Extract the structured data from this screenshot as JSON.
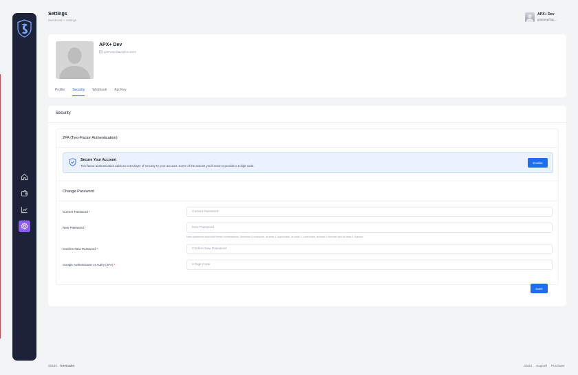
{
  "header": {
    "title": "Settings",
    "breadcrumb": [
      "Dashboard",
      "Settings"
    ],
    "breadcrumb_separator": "•",
    "user": {
      "name": "APX+ Dev",
      "email": "gateway@ap..."
    }
  },
  "sidebar": {
    "items": [
      {
        "name": "home",
        "icon": "home-icon",
        "active": false
      },
      {
        "name": "wallet",
        "icon": "wallet-icon",
        "active": false
      },
      {
        "name": "chart",
        "icon": "chart-line-icon",
        "active": false
      },
      {
        "name": "settings",
        "icon": "gear-icon",
        "active": true
      }
    ],
    "accent": "#8b5cf6"
  },
  "profile": {
    "name": "APX+ Dev",
    "email": "gateway@apxplus.store",
    "tabs": [
      {
        "label": "Profile",
        "active": false
      },
      {
        "label": "Security",
        "active": true
      },
      {
        "label": "Webhook",
        "active": false
      },
      {
        "label": "Api Key",
        "active": false
      }
    ]
  },
  "security": {
    "title": "Security",
    "twofa": {
      "title": "2FA (Two-Factor Authentication)",
      "alert_title": "Secure Your Account",
      "alert_text": "Two-factor authentication adds an extra layer of security to your account. Some of the actions you'll need to provide a 6 digit code.",
      "enable_label": "Enable"
    },
    "change_password": {
      "title": "Change Password",
      "fields": [
        {
          "label": "Current Password",
          "required": "*",
          "placeholder": "Current Password"
        },
        {
          "label": "New Password",
          "required": "*",
          "placeholder": "New Password"
        },
        {
          "label": "Confirm New Password",
          "required": "*",
          "placeholder": "Confirm New Password"
        },
        {
          "label": "Google Authenticator or Authy (2FA)",
          "required": "*",
          "placeholder": "6 Digit Code"
        }
      ],
      "hint": "New password must fulfil these combinations: Minimum 8 character, at least 1 Uppercase, at least 1 Lowercase, at least 1 Number and at least 1 Symbol.",
      "save_label": "Save"
    }
  },
  "footer": {
    "copyright": "2024©",
    "brand": "Treenodes",
    "links": [
      "About",
      "Support",
      "Purchase"
    ]
  },
  "colors": {
    "primary": "#1d6df2",
    "sidebar_bg": "#1c2237",
    "alert_bg": "#eaf2fd"
  }
}
